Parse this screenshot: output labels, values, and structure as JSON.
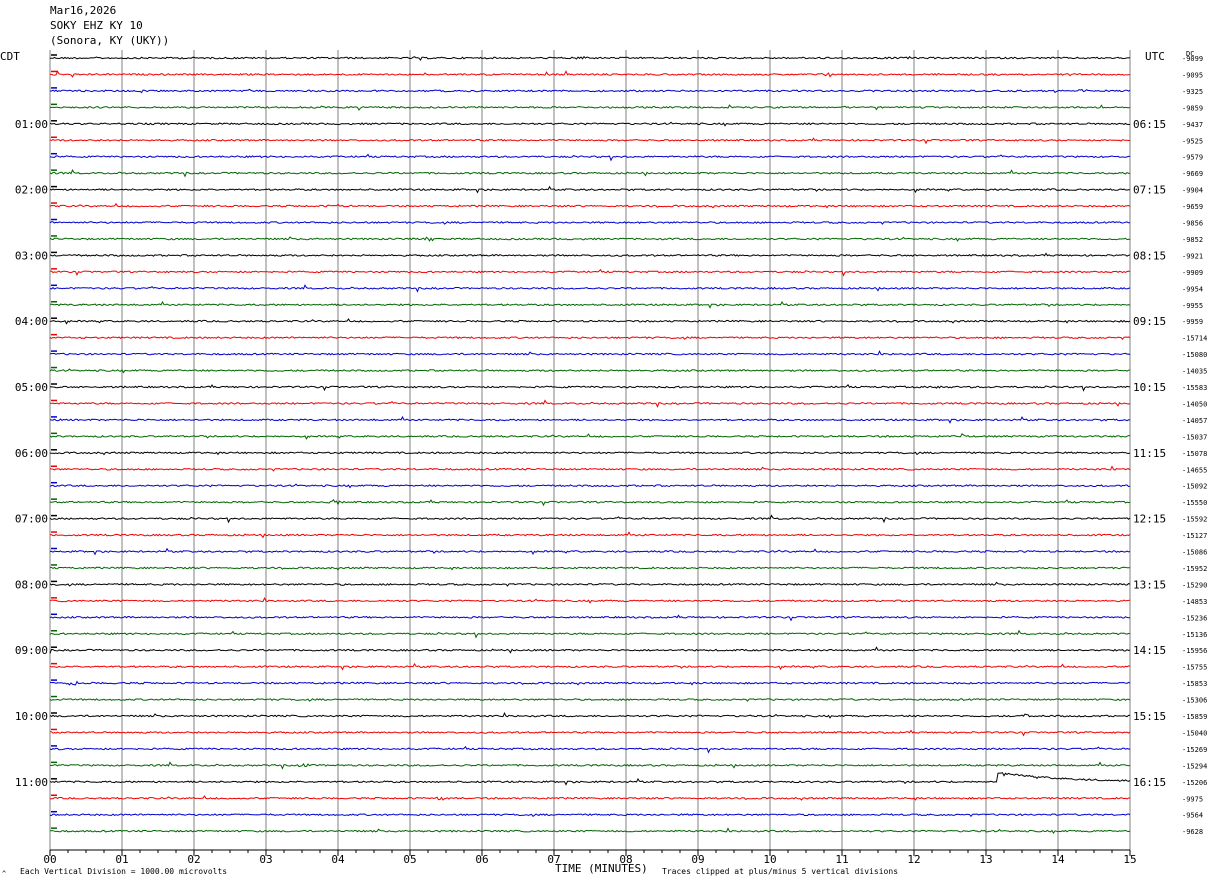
{
  "header": {
    "date": "Mar16,2026",
    "station": "SOKY EHZ KY 10",
    "location": "(Sonora, KY (UKY))"
  },
  "timezones": {
    "left": "CDT",
    "right": "UTC",
    "dc": "DC"
  },
  "footer": {
    "scale_note": "Each Vertical Division = 1000.00 microvolts",
    "xlabel": "TIME (MINUTES)",
    "clip_note": "Traces clipped at plus/minus 5 vertical divisions",
    "corner_mark": "^"
  },
  "colors": {
    "trace_cycle": [
      "#000000",
      "#ee0000",
      "#0000cc",
      "#006600"
    ],
    "grid": "#808080"
  },
  "chart_data": {
    "type": "line",
    "subtype": "helicorder",
    "x_axis": {
      "label": "TIME (MINUTES)",
      "range": [
        0,
        15
      ],
      "ticks": [
        "00",
        "01",
        "02",
        "03",
        "04",
        "05",
        "06",
        "07",
        "08",
        "09",
        "10",
        "11",
        "12",
        "13",
        "14",
        "15"
      ]
    },
    "row_labels_left": [
      "",
      "",
      "",
      "",
      "01:00",
      "",
      "",
      "",
      "02:00",
      "",
      "",
      "",
      "03:00",
      "",
      "",
      "",
      "04:00",
      "",
      "",
      "",
      "05:00",
      "",
      "",
      "",
      "06:00",
      "",
      "",
      "",
      "07:00",
      "",
      "",
      "",
      "08:00",
      "",
      "",
      "",
      "09:00",
      "",
      "",
      "",
      "10:00",
      "",
      "",
      "",
      "11:00",
      "",
      "",
      ""
    ],
    "row_labels_right": [
      "",
      "",
      "",
      "",
      "06:15",
      "",
      "",
      "",
      "07:15",
      "",
      "",
      "",
      "08:15",
      "",
      "",
      "",
      "09:15",
      "",
      "",
      "",
      "10:15",
      "",
      "",
      "",
      "11:15",
      "",
      "",
      "",
      "12:15",
      "",
      "",
      "",
      "13:15",
      "",
      "",
      "",
      "14:15",
      "",
      "",
      "",
      "15:15",
      "",
      "",
      "",
      "16:15",
      "",
      "",
      ""
    ],
    "dc_offsets": [
      "-9099",
      "-9095",
      "-9325",
      "-9859",
      "-9437",
      "-9525",
      "-9579",
      "-9669",
      "-9904",
      "-9659",
      "-9856",
      "-9852",
      "-9921",
      "-9909",
      "-9954",
      "-9955",
      "-9959",
      "-15714",
      "-15080",
      "-14035",
      "-15583",
      "-14050",
      "-14057",
      "-15037",
      "-15078",
      "-14655",
      "-15092",
      "-15550",
      "-15592",
      "-15127",
      "-15086",
      "-15952",
      "-15290",
      "-14853",
      "-15236",
      "-15136",
      "-15956",
      "-15755",
      "-15853",
      "-15306",
      "-15859",
      "-15040",
      "-15269",
      "-15294",
      "-15206",
      "-9975",
      "-9564",
      "-9628"
    ],
    "events": [
      {
        "row": 0,
        "minute": 7.4,
        "amp": 0.5
      },
      {
        "row": 1,
        "minute": 10.8,
        "amp": 0.4
      },
      {
        "row": 2,
        "minute": 14.35,
        "amp": 0.3
      },
      {
        "row": 9,
        "minute": 3.95,
        "amp": 0.4
      },
      {
        "row": 11,
        "minute": 5.25,
        "amp": 0.3
      },
      {
        "row": 20,
        "minute": 12.3,
        "amp": 0.4
      },
      {
        "row": 23,
        "minute": 12.65,
        "amp": 0.3
      },
      {
        "row": 25,
        "minute": 14.95,
        "amp": 0.3
      },
      {
        "row": 27,
        "minute": 3.95,
        "amp": 0.4
      },
      {
        "row": 38,
        "minute": 0.3,
        "amp": 0.5
      },
      {
        "row": 40,
        "minute": 13.55,
        "amp": 0.3
      },
      {
        "row": 43,
        "minute": 3.5,
        "amp": 0.4
      },
      {
        "row": 44,
        "minute": 13.15,
        "amp": 0.8,
        "decay": true
      },
      {
        "row": 45,
        "minute": 5.45,
        "amp": 0.3
      }
    ]
  }
}
